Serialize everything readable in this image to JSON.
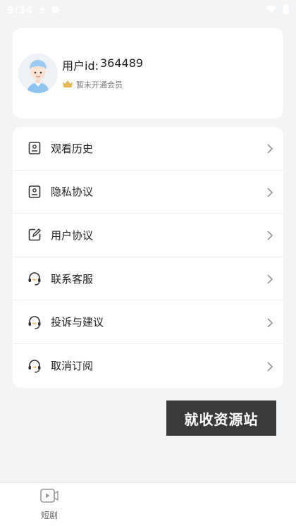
{
  "status_bar": {
    "time": "9:34"
  },
  "profile": {
    "user_id_label": "用户id:",
    "user_id_value": "364489",
    "vip_status": "暂未开通会员",
    "avatar_icon": "avatar-icon",
    "crown_icon": "crown-icon"
  },
  "menu": {
    "items": [
      {
        "label": "观看历史",
        "icon": "history-icon"
      },
      {
        "label": "隐私协议",
        "icon": "document-icon"
      },
      {
        "label": "用户协议",
        "icon": "edit-document-icon"
      },
      {
        "label": "联系客服",
        "icon": "headset-icon"
      },
      {
        "label": "投诉与建议",
        "icon": "headset-icon"
      },
      {
        "label": "取消订阅",
        "icon": "headset-icon"
      }
    ]
  },
  "watermark": {
    "text": "就收资源站"
  },
  "tabbar": {
    "tabs": [
      {
        "label": "短剧",
        "icon": "video-icon"
      }
    ]
  },
  "colors": {
    "background": "#f3f4f6",
    "card": "#ffffff",
    "crown": "#e8b64c",
    "watermark_bg": "#3a3a3a"
  }
}
